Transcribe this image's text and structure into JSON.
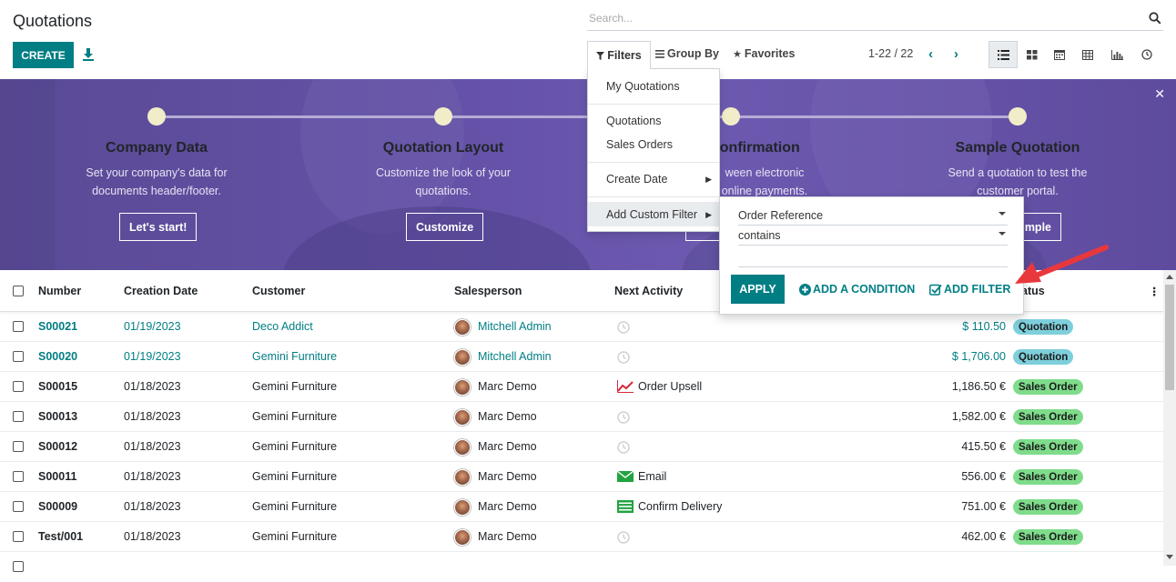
{
  "header": {
    "title": "Quotations",
    "create_label": "CREATE",
    "search_placeholder": "Search...",
    "filters_label": "Filters",
    "groupby_label": "Group By",
    "favorites_label": "Favorites",
    "pager": "1-22 / 22"
  },
  "banner": {
    "steps": [
      {
        "title": "Company Data",
        "desc1": "Set your company's data for",
        "desc2": "documents header/footer.",
        "button": "Let's start!"
      },
      {
        "title": "Quotation Layout",
        "desc1": "Customize the look of your",
        "desc2": "quotations.",
        "button": "Customize"
      },
      {
        "title": "Confirmation",
        "desc1": "ween electronic",
        "desc2": "online payments.",
        "button": ""
      },
      {
        "title": "Sample Quotation",
        "desc1": "Send a quotation to test the",
        "desc2": "customer portal.",
        "button": "mple"
      }
    ]
  },
  "filter_menu": {
    "items": [
      "My Quotations",
      "Quotations",
      "Sales Orders",
      "Create Date",
      "Add Custom Filter"
    ]
  },
  "custom_filter": {
    "field": "Order Reference",
    "operator": "contains",
    "value": "",
    "apply_label": "APPLY",
    "add_condition_label": "ADD A CONDITION",
    "add_filter_label": "ADD FILTER"
  },
  "table": {
    "columns": [
      "Number",
      "Creation Date",
      "Customer",
      "Salesperson",
      "Next Activity",
      "atus"
    ],
    "rows": [
      {
        "number": "S00021",
        "date": "01/19/2023",
        "customer": "Deco Addict",
        "salesperson": "Mitchell Admin",
        "activity": "",
        "activity_icon": "clock",
        "amount": "$ 110.50",
        "status": "Quotation",
        "highlight": true
      },
      {
        "number": "S00020",
        "date": "01/19/2023",
        "customer": "Gemini Furniture",
        "salesperson": "Mitchell Admin",
        "activity": "",
        "activity_icon": "clock",
        "amount": "$ 1,706.00",
        "status": "Quotation",
        "highlight": true
      },
      {
        "number": "S00015",
        "date": "01/18/2023",
        "customer": "Gemini Furniture",
        "salesperson": "Marc Demo",
        "activity": "Order Upsell",
        "activity_icon": "chart",
        "amount": "1,186.50 €",
        "status": "Sales Order",
        "highlight": false
      },
      {
        "number": "S00013",
        "date": "01/18/2023",
        "customer": "Gemini Furniture",
        "salesperson": "Marc Demo",
        "activity": "",
        "activity_icon": "clock",
        "amount": "1,582.00 €",
        "status": "Sales Order",
        "highlight": false
      },
      {
        "number": "S00012",
        "date": "01/18/2023",
        "customer": "Gemini Furniture",
        "salesperson": "Marc Demo",
        "activity": "",
        "activity_icon": "clock",
        "amount": "415.50 €",
        "status": "Sales Order",
        "highlight": false
      },
      {
        "number": "S00011",
        "date": "01/18/2023",
        "customer": "Gemini Furniture",
        "salesperson": "Marc Demo",
        "activity": "Email",
        "activity_icon": "email",
        "amount": "556.00 €",
        "status": "Sales Order",
        "highlight": false
      },
      {
        "number": "S00009",
        "date": "01/18/2023",
        "customer": "Gemini Furniture",
        "salesperson": "Marc Demo",
        "activity": "Confirm Delivery",
        "activity_icon": "list",
        "amount": "751.00 €",
        "status": "Sales Order",
        "highlight": false
      },
      {
        "number": "Test/001",
        "date": "01/18/2023",
        "customer": "Gemini Furniture",
        "salesperson": "Marc Demo",
        "activity": "",
        "activity_icon": "clock",
        "amount": "462.00 €",
        "status": "Sales Order",
        "highlight": false
      }
    ]
  },
  "colors": {
    "accent": "#017e84",
    "quotation_badge": "#7ecfdc",
    "sales_order_badge": "#7edc8b",
    "banner": "#6552a8"
  }
}
